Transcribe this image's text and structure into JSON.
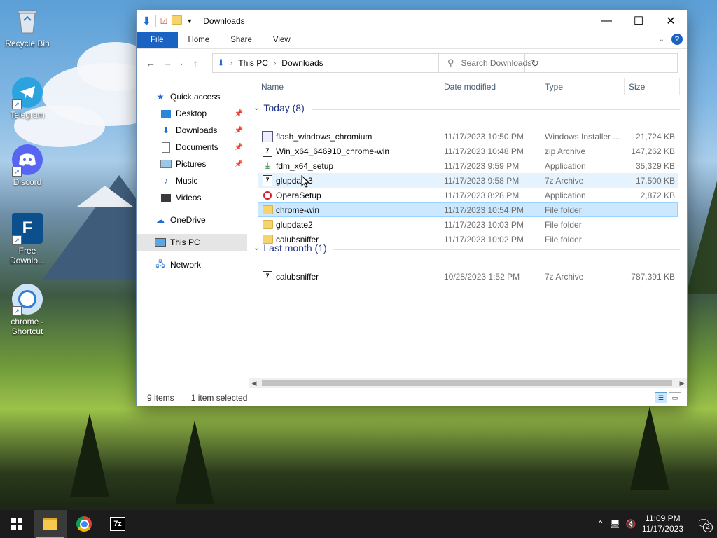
{
  "desktop": {
    "icons": [
      {
        "label": "Recycle Bin"
      },
      {
        "label": "Telegram"
      },
      {
        "label": "Discord"
      },
      {
        "label": "Free Downlo..."
      },
      {
        "label": "chrome - Shortcut"
      }
    ]
  },
  "window": {
    "title": "Downloads",
    "ribbon_tabs": [
      "File",
      "Home",
      "Share",
      "View"
    ],
    "address": {
      "segments": [
        "This PC",
        "Downloads"
      ]
    },
    "search": {
      "placeholder": "Search Downloads"
    },
    "nav": {
      "quick_access": "Quick access",
      "items": [
        "Desktop",
        "Downloads",
        "Documents",
        "Pictures",
        "Music",
        "Videos"
      ],
      "onedrive": "OneDrive",
      "this_pc": "This PC",
      "network": "Network"
    },
    "columns": [
      "Name",
      "Date modified",
      "Type",
      "Size"
    ],
    "groups": [
      {
        "label": "Today (8)",
        "files": [
          {
            "name": "flash_windows_chromium",
            "date": "11/17/2023 10:50 PM",
            "type": "Windows Installer ...",
            "size": "21,724 KB",
            "icon": "installer-icon"
          },
          {
            "name": "Win_x64_646910_chrome-win",
            "date": "11/17/2023 10:48 PM",
            "type": "zip Archive",
            "size": "147,262 KB",
            "icon": "archive-icon"
          },
          {
            "name": "fdm_x64_setup",
            "date": "11/17/2023 9:59 PM",
            "type": "Application",
            "size": "35,329 KB",
            "icon": "setup-icon"
          },
          {
            "name": "glupdate3",
            "date": "11/17/2023 9:58 PM",
            "type": "7z Archive",
            "size": "17,500 KB",
            "icon": "archive-icon"
          },
          {
            "name": "OperaSetup",
            "date": "11/17/2023 8:28 PM",
            "type": "Application",
            "size": "2,872 KB",
            "icon": "opera-icon"
          },
          {
            "name": "chrome-win",
            "date": "11/17/2023 10:54 PM",
            "type": "File folder",
            "size": "",
            "icon": "folder-icon"
          },
          {
            "name": "glupdate2",
            "date": "11/17/2023 10:03 PM",
            "type": "File folder",
            "size": "",
            "icon": "folder-icon"
          },
          {
            "name": "calubsniffer",
            "date": "11/17/2023 10:02 PM",
            "type": "File folder",
            "size": "",
            "icon": "folder-icon"
          }
        ]
      },
      {
        "label": "Last month (1)",
        "files": [
          {
            "name": "calubsniffer",
            "date": "10/28/2023 1:52 PM",
            "type": "7z Archive",
            "size": "787,391 KB",
            "icon": "archive-icon"
          }
        ]
      }
    ],
    "status": {
      "items": "9 items",
      "selected": "1 item selected"
    }
  },
  "taskbar": {
    "time": "11:09 PM",
    "date": "11/17/2023",
    "notifications": "2"
  }
}
